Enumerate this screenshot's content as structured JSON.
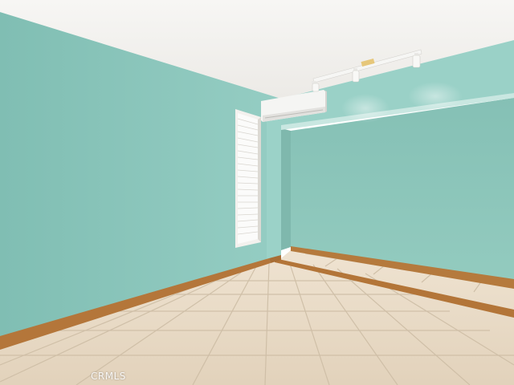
{
  "scene": {
    "subject": "empty room",
    "watermark": "CRMLS",
    "colors": {
      "ceiling": "#f4f3f1",
      "left_wall": "#8ec8be",
      "far_wall": "#98d0c5",
      "alcove_wall": "#8cc6bb",
      "baseboard": "#b5793c",
      "floor_tile": "#e6d7c2",
      "grout": "#cbbba3"
    },
    "objects": [
      "air-conditioner-unit",
      "track-light",
      "window-blinds",
      "tile-floor",
      "baseboard"
    ]
  }
}
